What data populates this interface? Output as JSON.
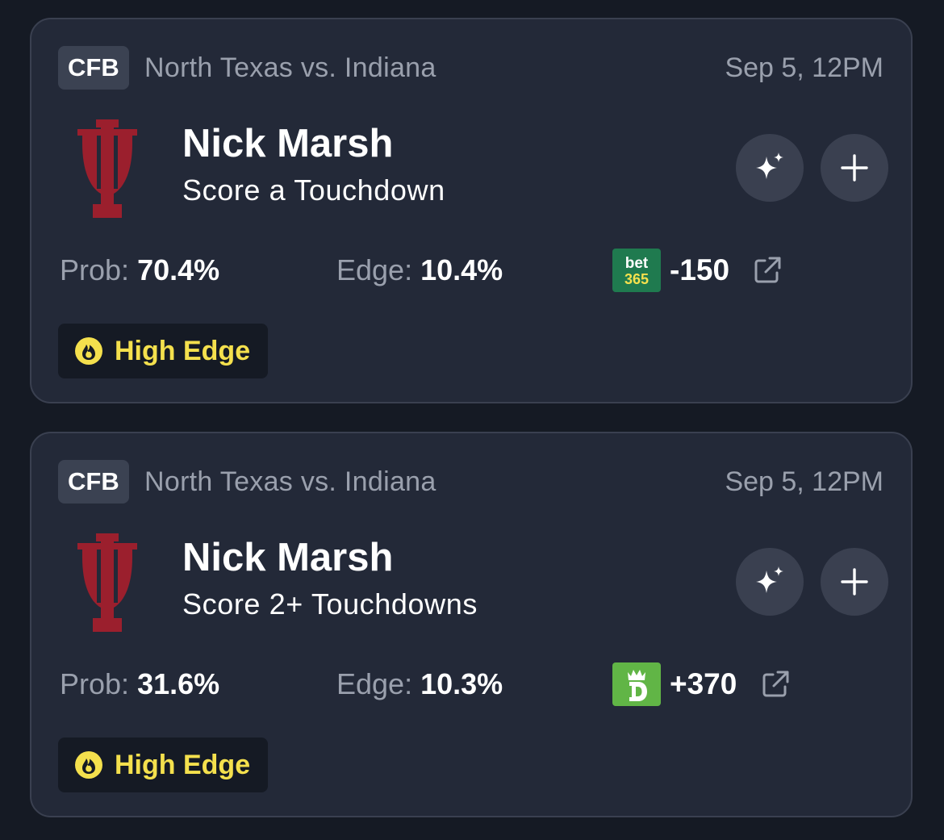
{
  "colors": {
    "page_bg": "#151a24",
    "card_bg": "#232938",
    "accent_yellow": "#f4e04d",
    "team_crimson": "#9b1f2d",
    "bet365_green": "#1f7a4f",
    "draftkings_green": "#61b546"
  },
  "cards": [
    {
      "league": "CFB",
      "matchup": "North Texas vs. Indiana",
      "datetime": "Sep 5, 12PM",
      "team_logo": "indiana-trident-logo",
      "player": "Nick Marsh",
      "market": "Score a Touchdown",
      "prob_label": "Prob:",
      "prob_value": "70.4%",
      "edge_label": "Edge:",
      "edge_value": "10.4%",
      "sportsbook": "bet365",
      "sportsbook_logo_text_top": "bet",
      "sportsbook_logo_text_bottom": "365",
      "odds": "-150",
      "tag": "High Edge",
      "tag_icon": "flame-icon",
      "ai_icon": "sparkle-icon",
      "add_icon": "plus-icon",
      "link_icon": "external-link-icon"
    },
    {
      "league": "CFB",
      "matchup": "North Texas vs. Indiana",
      "datetime": "Sep 5, 12PM",
      "team_logo": "indiana-trident-logo",
      "player": "Nick Marsh",
      "market": "Score 2+ Touchdowns",
      "prob_label": "Prob:",
      "prob_value": "31.6%",
      "edge_label": "Edge:",
      "edge_value": "10.3%",
      "sportsbook": "draftkings",
      "sportsbook_logo_text_top": "",
      "sportsbook_logo_text_bottom": "",
      "odds": "+370",
      "tag": "High Edge",
      "tag_icon": "flame-icon",
      "ai_icon": "sparkle-icon",
      "add_icon": "plus-icon",
      "link_icon": "external-link-icon"
    }
  ]
}
